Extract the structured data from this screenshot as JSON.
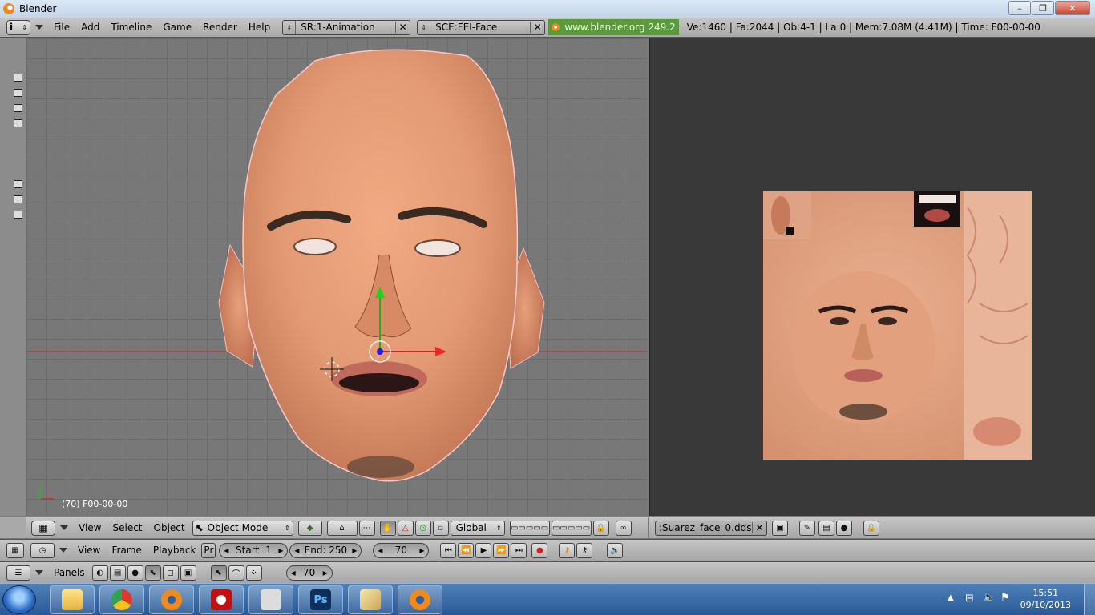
{
  "window": {
    "title": "Blender",
    "min": "–",
    "max": "❐",
    "close": "✕"
  },
  "menu": {
    "info": "i",
    "items": [
      "File",
      "Add",
      "Timeline",
      "Game",
      "Render",
      "Help"
    ],
    "screen_field": "SR:1-Animation",
    "scene_field": "SCE:FEI-Face",
    "website": "www.blender.org 249.2",
    "stats": "Ve:1460 | Fa:2044 | Ob:4-1 | La:0  | Mem:7.08M (4.41M)  | Time: F00-00-00"
  },
  "viewport": {
    "frame_label": "(70) F00-00-00"
  },
  "view3d_header": {
    "view": "View",
    "select": "Select",
    "object": "Object",
    "mode": "Object Mode",
    "orientation": "Global"
  },
  "image_header": {
    "image_name": ":Suarez_face_0.dds"
  },
  "timeline": {
    "view": "View",
    "frame": "Frame",
    "playback": "Playback",
    "pr": "Pr",
    "start": "Start: 1",
    "end": "End: 250",
    "current": "70"
  },
  "buttons": {
    "panels": "Panels",
    "frame": "70"
  },
  "taskbar": {
    "time": "15:51",
    "date": "09/10/2013"
  },
  "colors": {
    "accent_green": "#5a9a3a",
    "viewport_bg": "#787878",
    "image_bg": "#393939"
  }
}
